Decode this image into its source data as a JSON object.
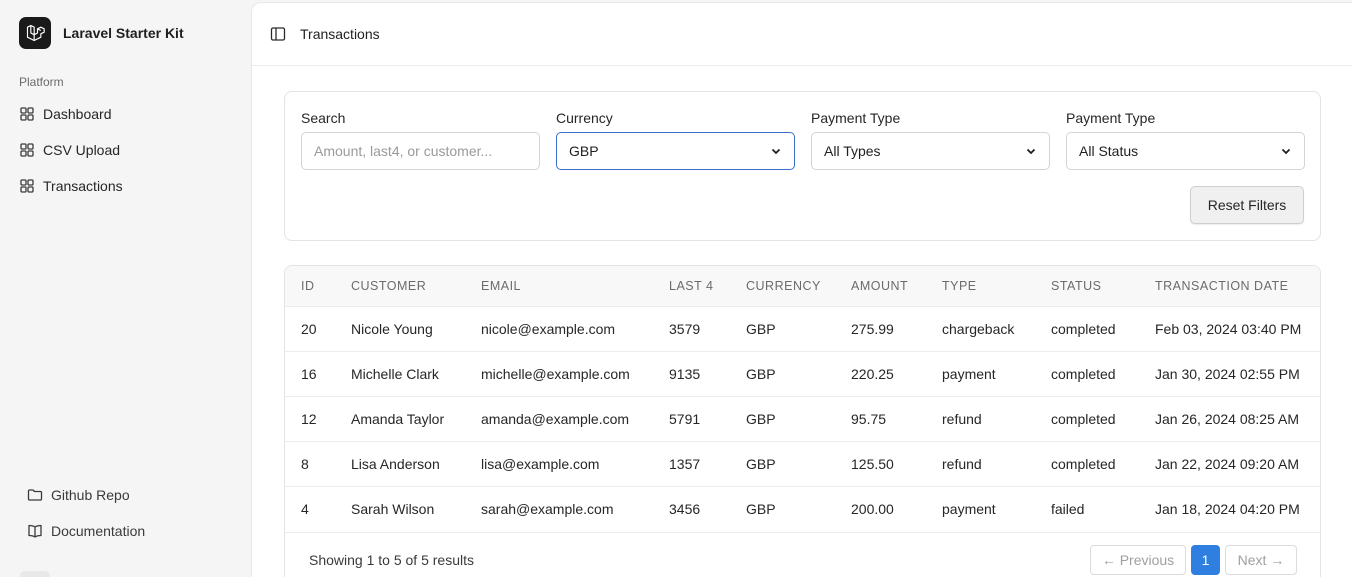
{
  "app": {
    "name": "Laravel Starter Kit"
  },
  "sidebar": {
    "group_label": "Platform",
    "items": [
      {
        "label": "Dashboard",
        "icon": "layout-grid-icon"
      },
      {
        "label": "CSV Upload",
        "icon": "layout-grid-icon"
      },
      {
        "label": "Transactions",
        "icon": "layout-grid-icon"
      }
    ],
    "footer": [
      {
        "label": "Github Repo",
        "icon": "folder-icon"
      },
      {
        "label": "Documentation",
        "icon": "book-open-icon"
      }
    ]
  },
  "header": {
    "breadcrumb": "Transactions"
  },
  "filters": {
    "search": {
      "label": "Search",
      "placeholder": "Amount, last4, or customer...",
      "value": ""
    },
    "currency": {
      "label": "Currency",
      "value": "GBP"
    },
    "payment_type": {
      "label": "Payment Type",
      "value": "All Types"
    },
    "status": {
      "label": "Payment Type",
      "value": "All Status"
    },
    "reset_label": "Reset Filters"
  },
  "table": {
    "columns": [
      "ID",
      "CUSTOMER",
      "EMAIL",
      "LAST 4",
      "CURRENCY",
      "AMOUNT",
      "TYPE",
      "STATUS",
      "TRANSACTION DATE"
    ],
    "rows": [
      [
        "20",
        "Nicole Young",
        "nicole@example.com",
        "3579",
        "GBP",
        "275.99",
        "chargeback",
        "completed",
        "Feb 03, 2024 03:40 PM"
      ],
      [
        "16",
        "Michelle Clark",
        "michelle@example.com",
        "9135",
        "GBP",
        "220.25",
        "payment",
        "completed",
        "Jan 30, 2024 02:55 PM"
      ],
      [
        "12",
        "Amanda Taylor",
        "amanda@example.com",
        "5791",
        "GBP",
        "95.75",
        "refund",
        "completed",
        "Jan 26, 2024 08:25 AM"
      ],
      [
        "8",
        "Lisa Anderson",
        "lisa@example.com",
        "1357",
        "GBP",
        "125.50",
        "refund",
        "completed",
        "Jan 22, 2024 09:20 AM"
      ],
      [
        "4",
        "Sarah Wilson",
        "sarah@example.com",
        "3456",
        "GBP",
        "200.00",
        "payment",
        "failed",
        "Jan 18, 2024 04:20 PM"
      ]
    ]
  },
  "pagination": {
    "showing": "Showing 1 to 5 of 5 results",
    "previous": "← Previous",
    "current": "1",
    "next": "Next →"
  },
  "colors": {
    "accent": "#2f7fe0",
    "focus_border": "#3b6fc9"
  }
}
